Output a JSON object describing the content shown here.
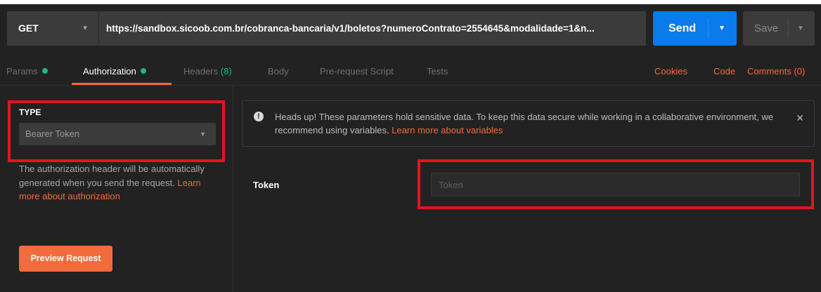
{
  "request": {
    "method": "GET",
    "url": "https://sandbox.sicoob.com.br/cobranca-bancaria/v1/boletos?numeroContrato=2554645&modalidade=1&n...",
    "send_label": "Send",
    "save_label": "Save"
  },
  "tabs": [
    {
      "label": "Params",
      "status_dot": true
    },
    {
      "label": "Authorization",
      "status_dot": true,
      "active": true
    },
    {
      "label": "Headers",
      "count": "(8)"
    },
    {
      "label": "Body"
    },
    {
      "label": "Pre-request Script"
    },
    {
      "label": "Tests"
    }
  ],
  "right_links": [
    "Cookies",
    "Code",
    "Comments (0)"
  ],
  "auth": {
    "type_label": "TYPE",
    "type_value": "Bearer Token",
    "description": "The authorization header will be automatically generated when you send the request.",
    "learn_more": "Learn more about authorization",
    "preview_button": "Preview Request"
  },
  "alert": {
    "text": "Heads up! These parameters hold sensitive data. To keep this data secure while working in a collaborative environment, we recommend using variables.",
    "link": "Learn more about variables"
  },
  "token": {
    "label": "Token",
    "placeholder": "Token",
    "value": ""
  },
  "colors": {
    "background": "#222222",
    "accent_orange": "#f26b3a",
    "send_blue": "#097bed",
    "status_green": "#26b47f",
    "annotation_red": "#e2151f"
  },
  "icons": [
    "caret-down-icon",
    "info-icon",
    "close-icon"
  ]
}
